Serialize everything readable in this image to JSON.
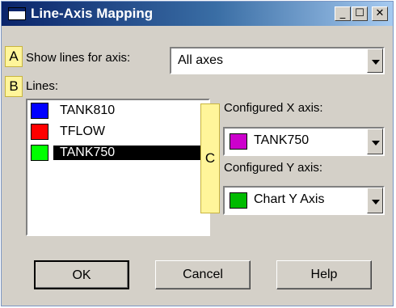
{
  "window": {
    "title": "Line-Axis Mapping"
  },
  "titlebar": {
    "minimize_glyph": "_",
    "maximize_glyph": "☐",
    "close_glyph": "✕"
  },
  "callouts": {
    "a": "A",
    "b": "B",
    "c": "C"
  },
  "show_lines": {
    "label": "Show lines for axis:",
    "selected": "All axes"
  },
  "lines": {
    "label": "Lines:",
    "items": [
      {
        "name": "TANK810",
        "color": "#0000ff",
        "selected": false
      },
      {
        "name": "TFLOW",
        "color": "#ff0000",
        "selected": false
      },
      {
        "name": "TANK750",
        "color": "#00ff00",
        "selected": true
      }
    ]
  },
  "x_axis": {
    "label": "Configured X axis:",
    "selected": "TANK750",
    "color": "#cc00cc"
  },
  "y_axis": {
    "label": "Configured Y axis:",
    "selected": "Chart Y Axis",
    "color": "#00bb00"
  },
  "buttons": {
    "ok": "OK",
    "cancel": "Cancel",
    "help": "Help"
  },
  "colors": {
    "title_start": "#0a246a",
    "title_end": "#a6caf0",
    "dialog_bg": "#d4d0c8",
    "callout": "#fff59a"
  }
}
